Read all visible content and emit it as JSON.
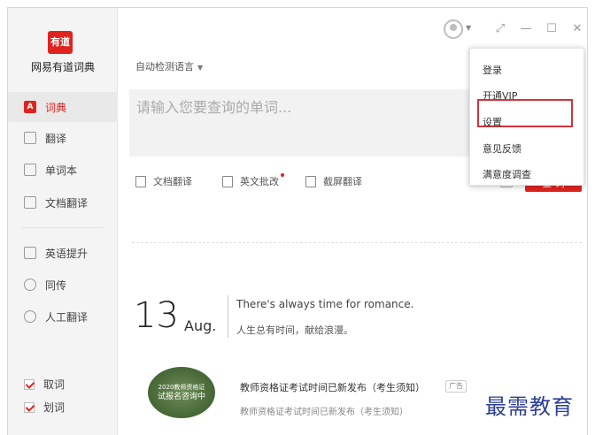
{
  "app": {
    "logo_text": "有道",
    "name": "网易有道词典"
  },
  "sidebar": {
    "items": [
      {
        "label": "词典",
        "icon": "A"
      },
      {
        "label": "翻译"
      },
      {
        "label": "单词本"
      },
      {
        "label": "文档翻译"
      },
      {
        "label": "英语提升"
      },
      {
        "label": "同传"
      },
      {
        "label": "人工翻译"
      }
    ],
    "checks": [
      {
        "label": "取词",
        "checked": true
      },
      {
        "label": "划词",
        "checked": true
      }
    ]
  },
  "top": {
    "language_select": "自动检测语言"
  },
  "search": {
    "placeholder": "请输入您要查询的单词..."
  },
  "tools": {
    "doc_translate": "文档翻译",
    "essay_review": "英文批改",
    "screenshot_translate": "截屏翻译",
    "query_button": "查 词"
  },
  "menu": {
    "login": "登录",
    "vip": "开通VIP",
    "settings": "设置",
    "feedback": "意见反馈",
    "survey": "满意度调查"
  },
  "daily": {
    "day": "13",
    "month": "Aug.",
    "sentence_en": "There's always time for romance.",
    "sentence_cn": "人生总有时间，献给浪漫。"
  },
  "ad": {
    "image_line1": "2020教师资格证",
    "image_line2": "试报名咨询中",
    "title": "教师资格证考试时间已新发布（考生须知）",
    "badge": "广告",
    "subtitle": "教师资格证考试时间已新发布（考生须知）"
  },
  "watermark": "最需教育",
  "colors": {
    "accent": "#e0231e",
    "highlight_box": "#d0353a",
    "watermark": "#2c3e9a"
  }
}
